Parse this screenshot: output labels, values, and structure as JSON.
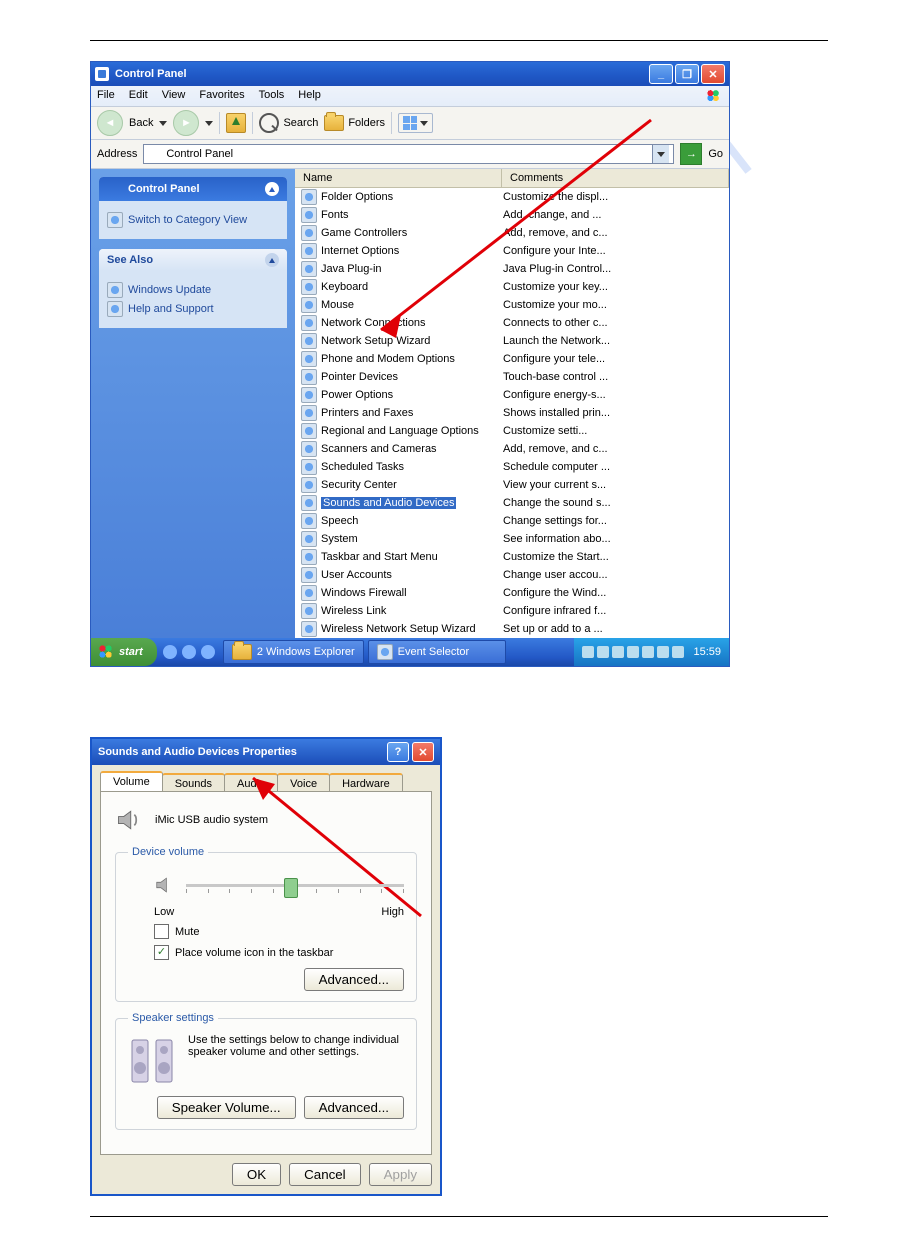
{
  "watermark": "manualshelf.com",
  "control_panel": {
    "title": "Control Panel",
    "menus": [
      "File",
      "Edit",
      "View",
      "Favorites",
      "Tools",
      "Help"
    ],
    "toolbar": {
      "back": "Back",
      "search": "Search",
      "folders": "Folders"
    },
    "address_label": "Address",
    "address_value": "Control Panel",
    "go_label": "Go",
    "sidebar": {
      "panel1_title": "Control Panel",
      "switch": "Switch to Category View",
      "panel2_title": "See Also",
      "links": [
        "Windows Update",
        "Help and Support"
      ]
    },
    "columns": {
      "name": "Name",
      "comments": "Comments"
    },
    "items": [
      {
        "name": "Folder Options",
        "comment": "Customize the displ..."
      },
      {
        "name": "Fonts",
        "comment": "Add, change, and ..."
      },
      {
        "name": "Game Controllers",
        "comment": "Add, remove, and c..."
      },
      {
        "name": "Internet Options",
        "comment": "Configure your Inte..."
      },
      {
        "name": "Java Plug-in",
        "comment": "Java Plug-in Control..."
      },
      {
        "name": "Keyboard",
        "comment": "Customize your key..."
      },
      {
        "name": "Mouse",
        "comment": "Customize your mo..."
      },
      {
        "name": "Network Connections",
        "comment": "Connects to other c..."
      },
      {
        "name": "Network Setup Wizard",
        "comment": "Launch the Network..."
      },
      {
        "name": "Phone and Modem Options",
        "comment": "Configure your tele..."
      },
      {
        "name": "Pointer Devices",
        "comment": "Touch-base control ..."
      },
      {
        "name": "Power Options",
        "comment": "Configure energy-s..."
      },
      {
        "name": "Printers and Faxes",
        "comment": "Shows installed prin..."
      },
      {
        "name": "Regional and Language Options",
        "comment": "Customize setti..."
      },
      {
        "name": "Scanners and Cameras",
        "comment": "Add, remove, and c..."
      },
      {
        "name": "Scheduled Tasks",
        "comment": "Schedule computer ..."
      },
      {
        "name": "Security Center",
        "comment": "View your current s..."
      },
      {
        "name": "Sounds and Audio Devices",
        "comment": "Change the sound s...",
        "hl": true
      },
      {
        "name": "Speech",
        "comment": "Change settings for..."
      },
      {
        "name": "System",
        "comment": "See information abo..."
      },
      {
        "name": "Taskbar and Start Menu",
        "comment": "Customize the Start..."
      },
      {
        "name": "User Accounts",
        "comment": "Change user accou..."
      },
      {
        "name": "Windows Firewall",
        "comment": "Configure the Wind..."
      },
      {
        "name": "Wireless Link",
        "comment": "Configure infrared f..."
      },
      {
        "name": "Wireless Network Setup Wizard",
        "comment": "Set up or add to a ..."
      }
    ],
    "taskbar": {
      "start": "start",
      "task_buttons": [
        "2 Windows Explorer",
        "Event Selector"
      ],
      "clock": "15:59"
    }
  },
  "dialog": {
    "title": "Sounds and Audio Devices Properties",
    "tabs": [
      "Volume",
      "Sounds",
      "Audio",
      "Voice",
      "Hardware"
    ],
    "active_tab": 0,
    "device_name": "iMic USB audio system",
    "group_volume": "Device volume",
    "low": "Low",
    "high": "High",
    "mute": "Mute",
    "place_icon": "Place volume icon in the taskbar",
    "advanced": "Advanced...",
    "group_speaker": "Speaker settings",
    "speaker_desc": "Use the settings below to change individual speaker volume and other settings.",
    "speaker_volume": "Speaker Volume...",
    "ok": "OK",
    "cancel": "Cancel",
    "apply": "Apply"
  }
}
